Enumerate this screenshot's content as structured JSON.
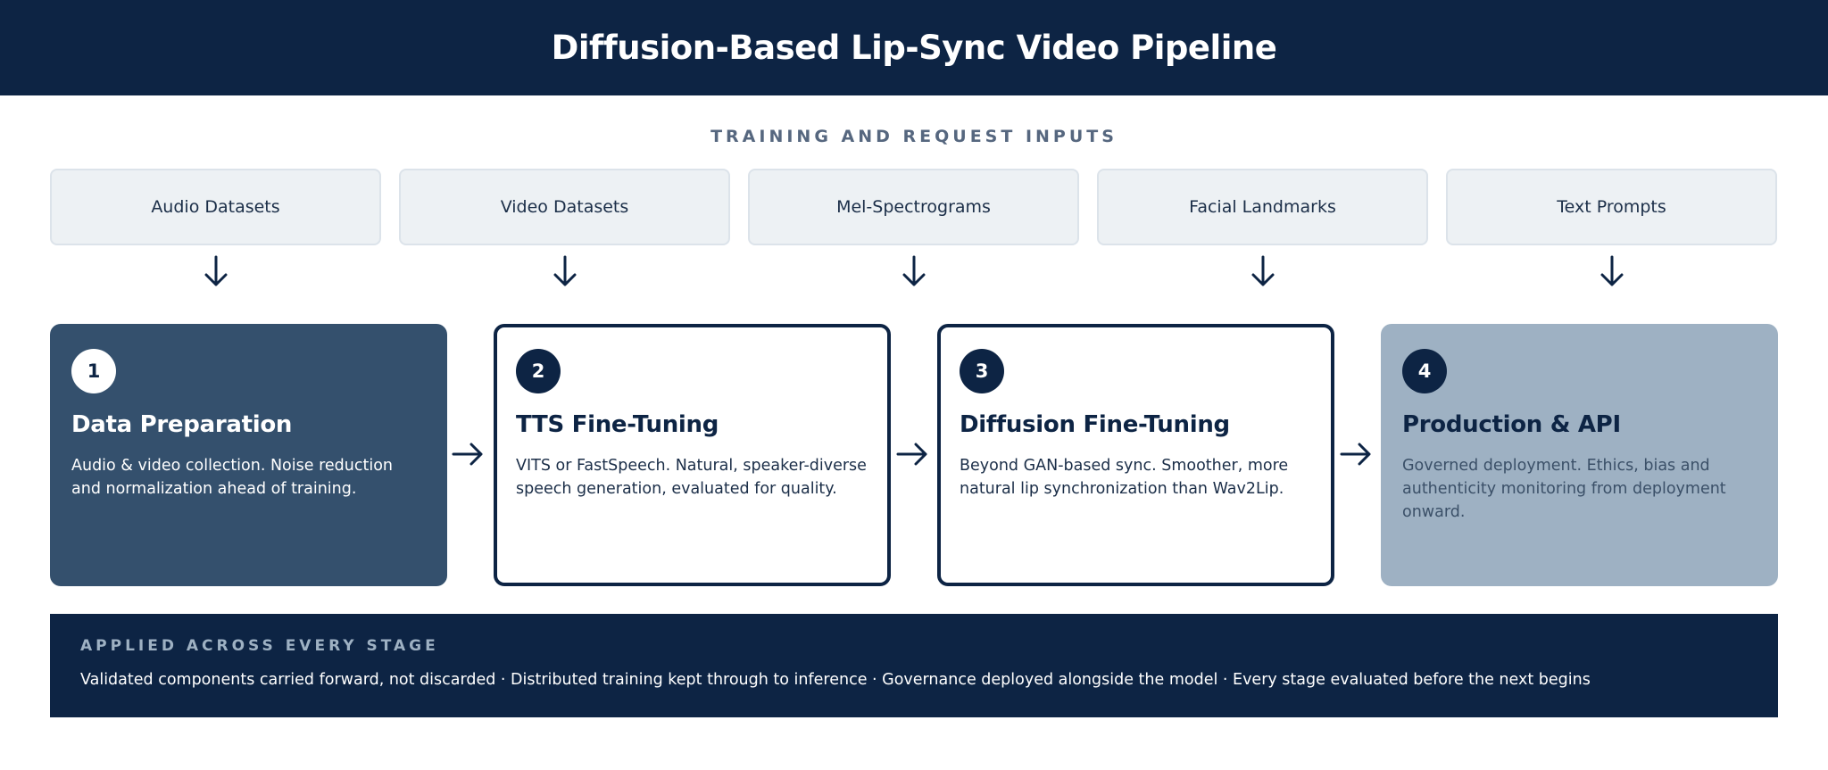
{
  "title": "Diffusion-Based Lip-Sync Video Pipeline",
  "inputs": {
    "label": "TRAINING AND REQUEST INPUTS",
    "items": [
      "Audio Datasets",
      "Video Datasets",
      "Mel-Spectrograms",
      "Facial Landmarks",
      "Text Prompts"
    ]
  },
  "stages": [
    {
      "number": "1",
      "title": "Data Preparation",
      "description": "Audio & video collection. Noise reduction and normalization ahead of training."
    },
    {
      "number": "2",
      "title": "TTS Fine-Tuning",
      "description": "VITS or FastSpeech. Natural, speaker-diverse speech generation, evaluated for quality."
    },
    {
      "number": "3",
      "title": "Diffusion Fine-Tuning",
      "description": "Beyond GAN-based sync. Smoother, more natural lip synchronization than Wav2Lip."
    },
    {
      "number": "4",
      "title": "Production & API",
      "description": "Governed deployment. Ethics, bias and authenticity monitoring from deployment onward."
    }
  ],
  "footer": {
    "label": "APPLIED ACROSS EVERY STAGE",
    "text": "Validated components carried forward, not discarded · Distributed training kept through to inference · Governance deployed alongside the model · Every stage evaluated before the next begins"
  },
  "colors": {
    "navy": "#0d2444",
    "stage1": "#34506d",
    "stage4": "#9eb1c3",
    "input_bg": "#edf1f4"
  }
}
